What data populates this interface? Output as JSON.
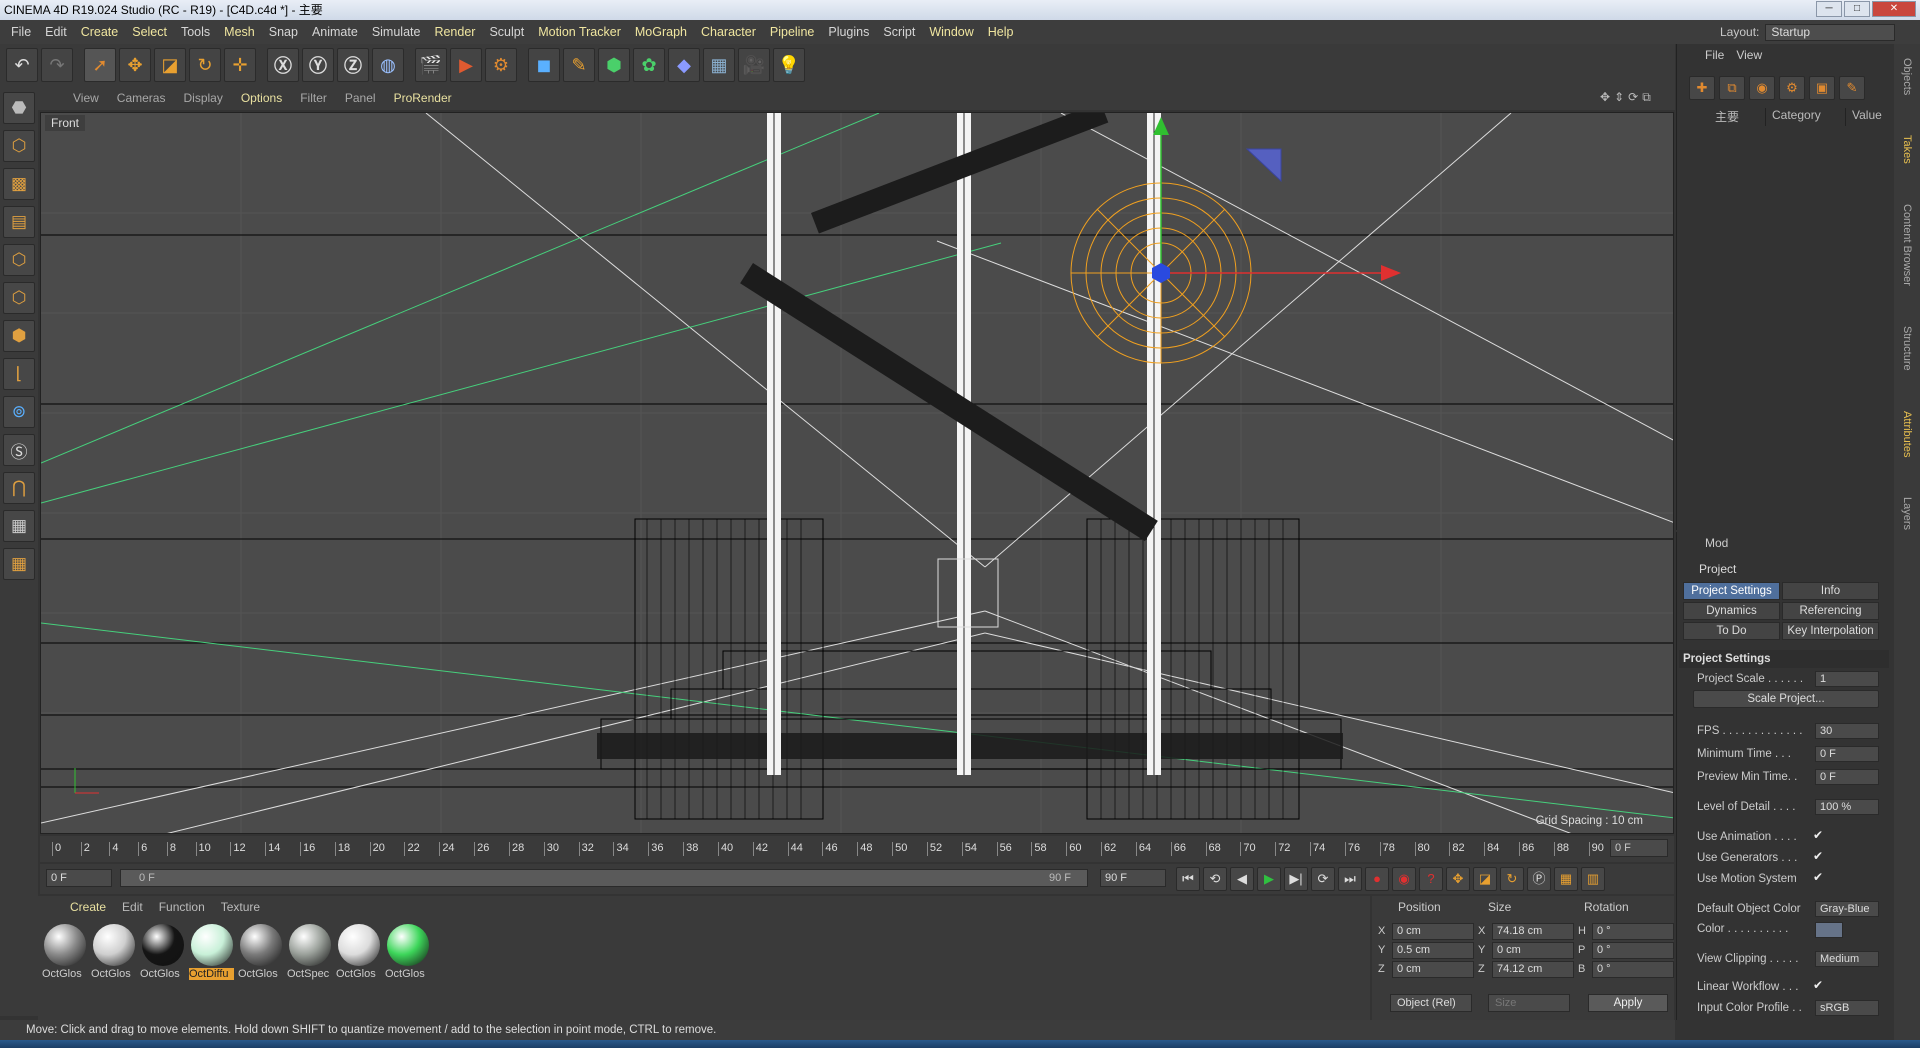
{
  "window": {
    "title": "CINEMA 4D R19.024 Studio (RC - R19) - [C4D.c4d *] - 主要"
  },
  "menubar": [
    "File",
    "Edit",
    "Create",
    "Select",
    "Tools",
    "Mesh",
    "Snap",
    "Animate",
    "Simulate",
    "Render",
    "Sculpt",
    "Motion Tracker",
    "MoGraph",
    "Character",
    "Pipeline",
    "Plugins",
    "Script",
    "Window",
    "Help"
  ],
  "layout": {
    "label": "Layout:",
    "value": "Startup"
  },
  "viewport": {
    "menu": [
      "View",
      "Cameras",
      "Display",
      "Options",
      "Filter",
      "Panel",
      "ProRender"
    ],
    "label": "Front",
    "grid_spacing": "Grid Spacing : 10 cm"
  },
  "timeline": {
    "ticks": [
      "0",
      "2",
      "4",
      "6",
      "8",
      "10",
      "12",
      "14",
      "16",
      "18",
      "20",
      "22",
      "24",
      "26",
      "28",
      "30",
      "32",
      "34",
      "36",
      "38",
      "40",
      "42",
      "44",
      "46",
      "48",
      "50",
      "52",
      "54",
      "56",
      "58",
      "60",
      "62",
      "64",
      "66",
      "68",
      "70",
      "72",
      "74",
      "76",
      "78",
      "80",
      "82",
      "84",
      "86",
      "88",
      "90"
    ],
    "end_frame": "0 F",
    "current": "0 F",
    "slider_start": "0 F",
    "slider_end": "90 F",
    "max": "90 F"
  },
  "materials": {
    "menu": [
      "Create",
      "Edit",
      "Function",
      "Texture"
    ],
    "items": [
      {
        "label": "OctGlos",
        "color": "#8a8a8a"
      },
      {
        "label": "OctGlos",
        "color": "#cfcfcf"
      },
      {
        "label": "OctGlos",
        "color": "#151515"
      },
      {
        "label": "OctDiffu",
        "color": "#c8f0d8",
        "selected": true
      },
      {
        "label": "OctGlos",
        "color": "#7a7a7a"
      },
      {
        "label": "OctSpec",
        "color": "#9aa09a"
      },
      {
        "label": "OctGlos",
        "color": "#dcdcdc"
      },
      {
        "label": "OctGlos",
        "color": "#3dd65a"
      }
    ]
  },
  "coordinates": {
    "headers": [
      "Position",
      "Size",
      "Rotation"
    ],
    "rows": [
      {
        "pos_axis": "X",
        "pos": "0 cm",
        "size_axis": "X",
        "size": "74.18 cm",
        "rot_axis": "H",
        "rot": "0 °"
      },
      {
        "pos_axis": "Y",
        "pos": "0.5 cm",
        "size_axis": "Y",
        "size": "0 cm",
        "rot_axis": "P",
        "rot": "0 °"
      },
      {
        "pos_axis": "Z",
        "pos": "0 cm",
        "size_axis": "Z",
        "size": "74.12 cm",
        "rot_axis": "B",
        "rot": "0 °"
      }
    ],
    "mode": "Object (Rel)",
    "size_mode": "Size",
    "apply": "Apply"
  },
  "status": "Move: Click and drag to move elements. Hold down SHIFT to quantize movement / add to the selection in point mode, CTRL to remove.",
  "object_manager": {
    "menu": [
      "File",
      "View"
    ],
    "columns": [
      "主要",
      "Category",
      "Value"
    ]
  },
  "right_tabs": [
    "Objects",
    "Takes",
    "Content Browser",
    "Structure",
    "Attributes",
    "Layers"
  ],
  "attributes": {
    "menu": "Mod",
    "object": "Project",
    "tabs": [
      "Project Settings",
      "Info",
      "Dynamics",
      "Referencing",
      "To Do",
      "Key Interpolation"
    ],
    "section": "Project Settings",
    "props": [
      {
        "label": "Project Scale . . . . . .",
        "value": "1"
      },
      {
        "label": "FPS . . . . . . . . . . . . .",
        "value": "30"
      },
      {
        "label": "Minimum Time . . .",
        "value": "0 F"
      },
      {
        "label": "Preview Min Time. .",
        "value": "0 F"
      },
      {
        "label": "Level of Detail . . . .",
        "value": "100 %"
      },
      {
        "label": "Default Object Color",
        "value": "Gray-Blue"
      },
      {
        "label": "View Clipping . . . . .",
        "value": "Medium"
      },
      {
        "label": "Input Color Profile . .",
        "value": "sRGB"
      }
    ],
    "checks": [
      "Use Animation . . . .",
      "Use Generators . . .",
      "Use Motion System",
      "Linear Workflow . . ."
    ],
    "color_label": "Color . . . . . . . . . .",
    "scale_button": "Scale Project..."
  }
}
